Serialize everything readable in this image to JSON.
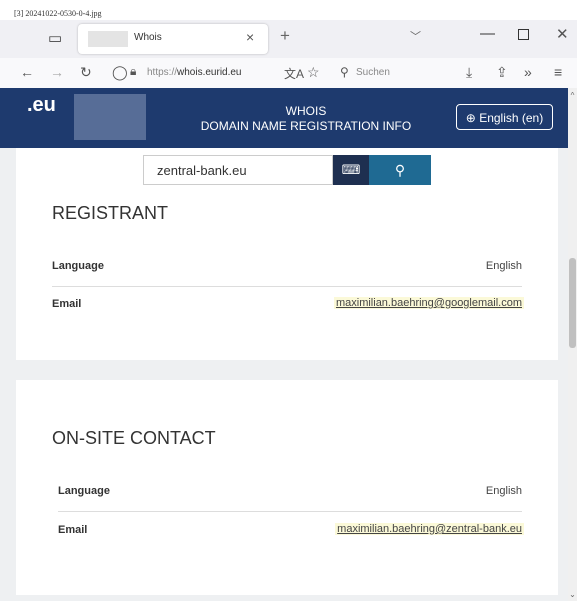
{
  "caption": "[3] 20241022-0530-0-4.jpg",
  "browser": {
    "tab_title": "Whois",
    "url_scheme": "https://",
    "url_host": "whois.eurid.eu",
    "search_placeholder": "Suchen"
  },
  "header": {
    "logo": ".eu",
    "title_line1": "WHOIS",
    "title_line2": "DOMAIN NAME REGISTRATION INFO",
    "language_button": "English (en)"
  },
  "search": {
    "value": "zentral-bank.eu"
  },
  "registrant": {
    "title": "REGISTRANT",
    "language_label": "Language",
    "language_value": "English",
    "email_label": "Email",
    "email_value": "maximilian.baehring@googlemail.com"
  },
  "onsite": {
    "title": "ON-SITE CONTACT",
    "language_label": "Language",
    "language_value": "English",
    "email_label": "Email",
    "email_value": "maximilian.baehring@zentral-bank.eu"
  },
  "colors": {
    "header_bg": "#1e3a6e",
    "search_button": "#1f6a93",
    "email_highlight": "#fbf9d8"
  }
}
